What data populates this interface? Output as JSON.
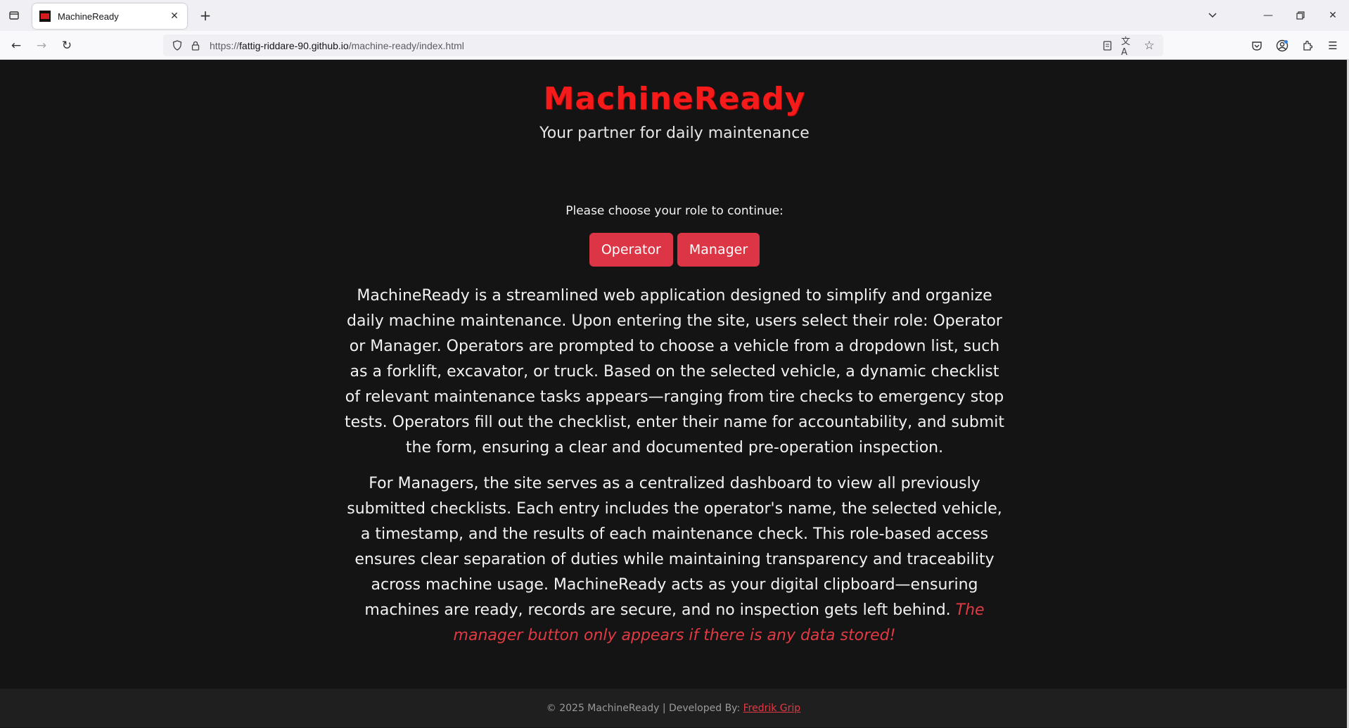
{
  "browser": {
    "tab_title": "MachineReady",
    "url_scheme": "https://",
    "url_host": "fattig-riddare-90.github.io",
    "url_path": "/machine-ready/index.html"
  },
  "header": {
    "brand": "MachineReady",
    "tagline": "Your partner for daily maintenance"
  },
  "roles": {
    "prompt": "Please choose your role to continue:",
    "operator_label": "Operator",
    "manager_label": "Manager"
  },
  "description": {
    "paragraph1": "MachineReady is a streamlined web application designed to simplify and organize daily machine maintenance. Upon entering the site, users select their role: Operator or Manager. Operators are prompted to choose a vehicle from a dropdown list, such as a forklift, excavator, or truck. Based on the selected vehicle, a dynamic checklist of relevant maintenance tasks appears—ranging from tire checks to emergency stop tests. Operators fill out the checklist, enter their name for accountability, and submit the form, ensuring a clear and documented pre-operation inspection.",
    "paragraph2": "For Managers, the site serves as a centralized dashboard to view all previously submitted checklists. Each entry includes the operator's name, the selected vehicle, a timestamp, and the results of each maintenance check. This role-based access ensures clear separation of duties while maintaining transparency and traceability across machine usage. MachineReady acts as your digital clipboard—ensuring machines are ready, records are secure, and no inspection gets left behind.",
    "note": "The manager button only appears if there is any data stored!"
  },
  "footer": {
    "text": "© 2025 MachineReady | Developed By: ",
    "author": "Fredrik Grip"
  },
  "colors": {
    "brand_red": "#f51b1b",
    "button_red": "#dc3545",
    "background": "#141414"
  }
}
